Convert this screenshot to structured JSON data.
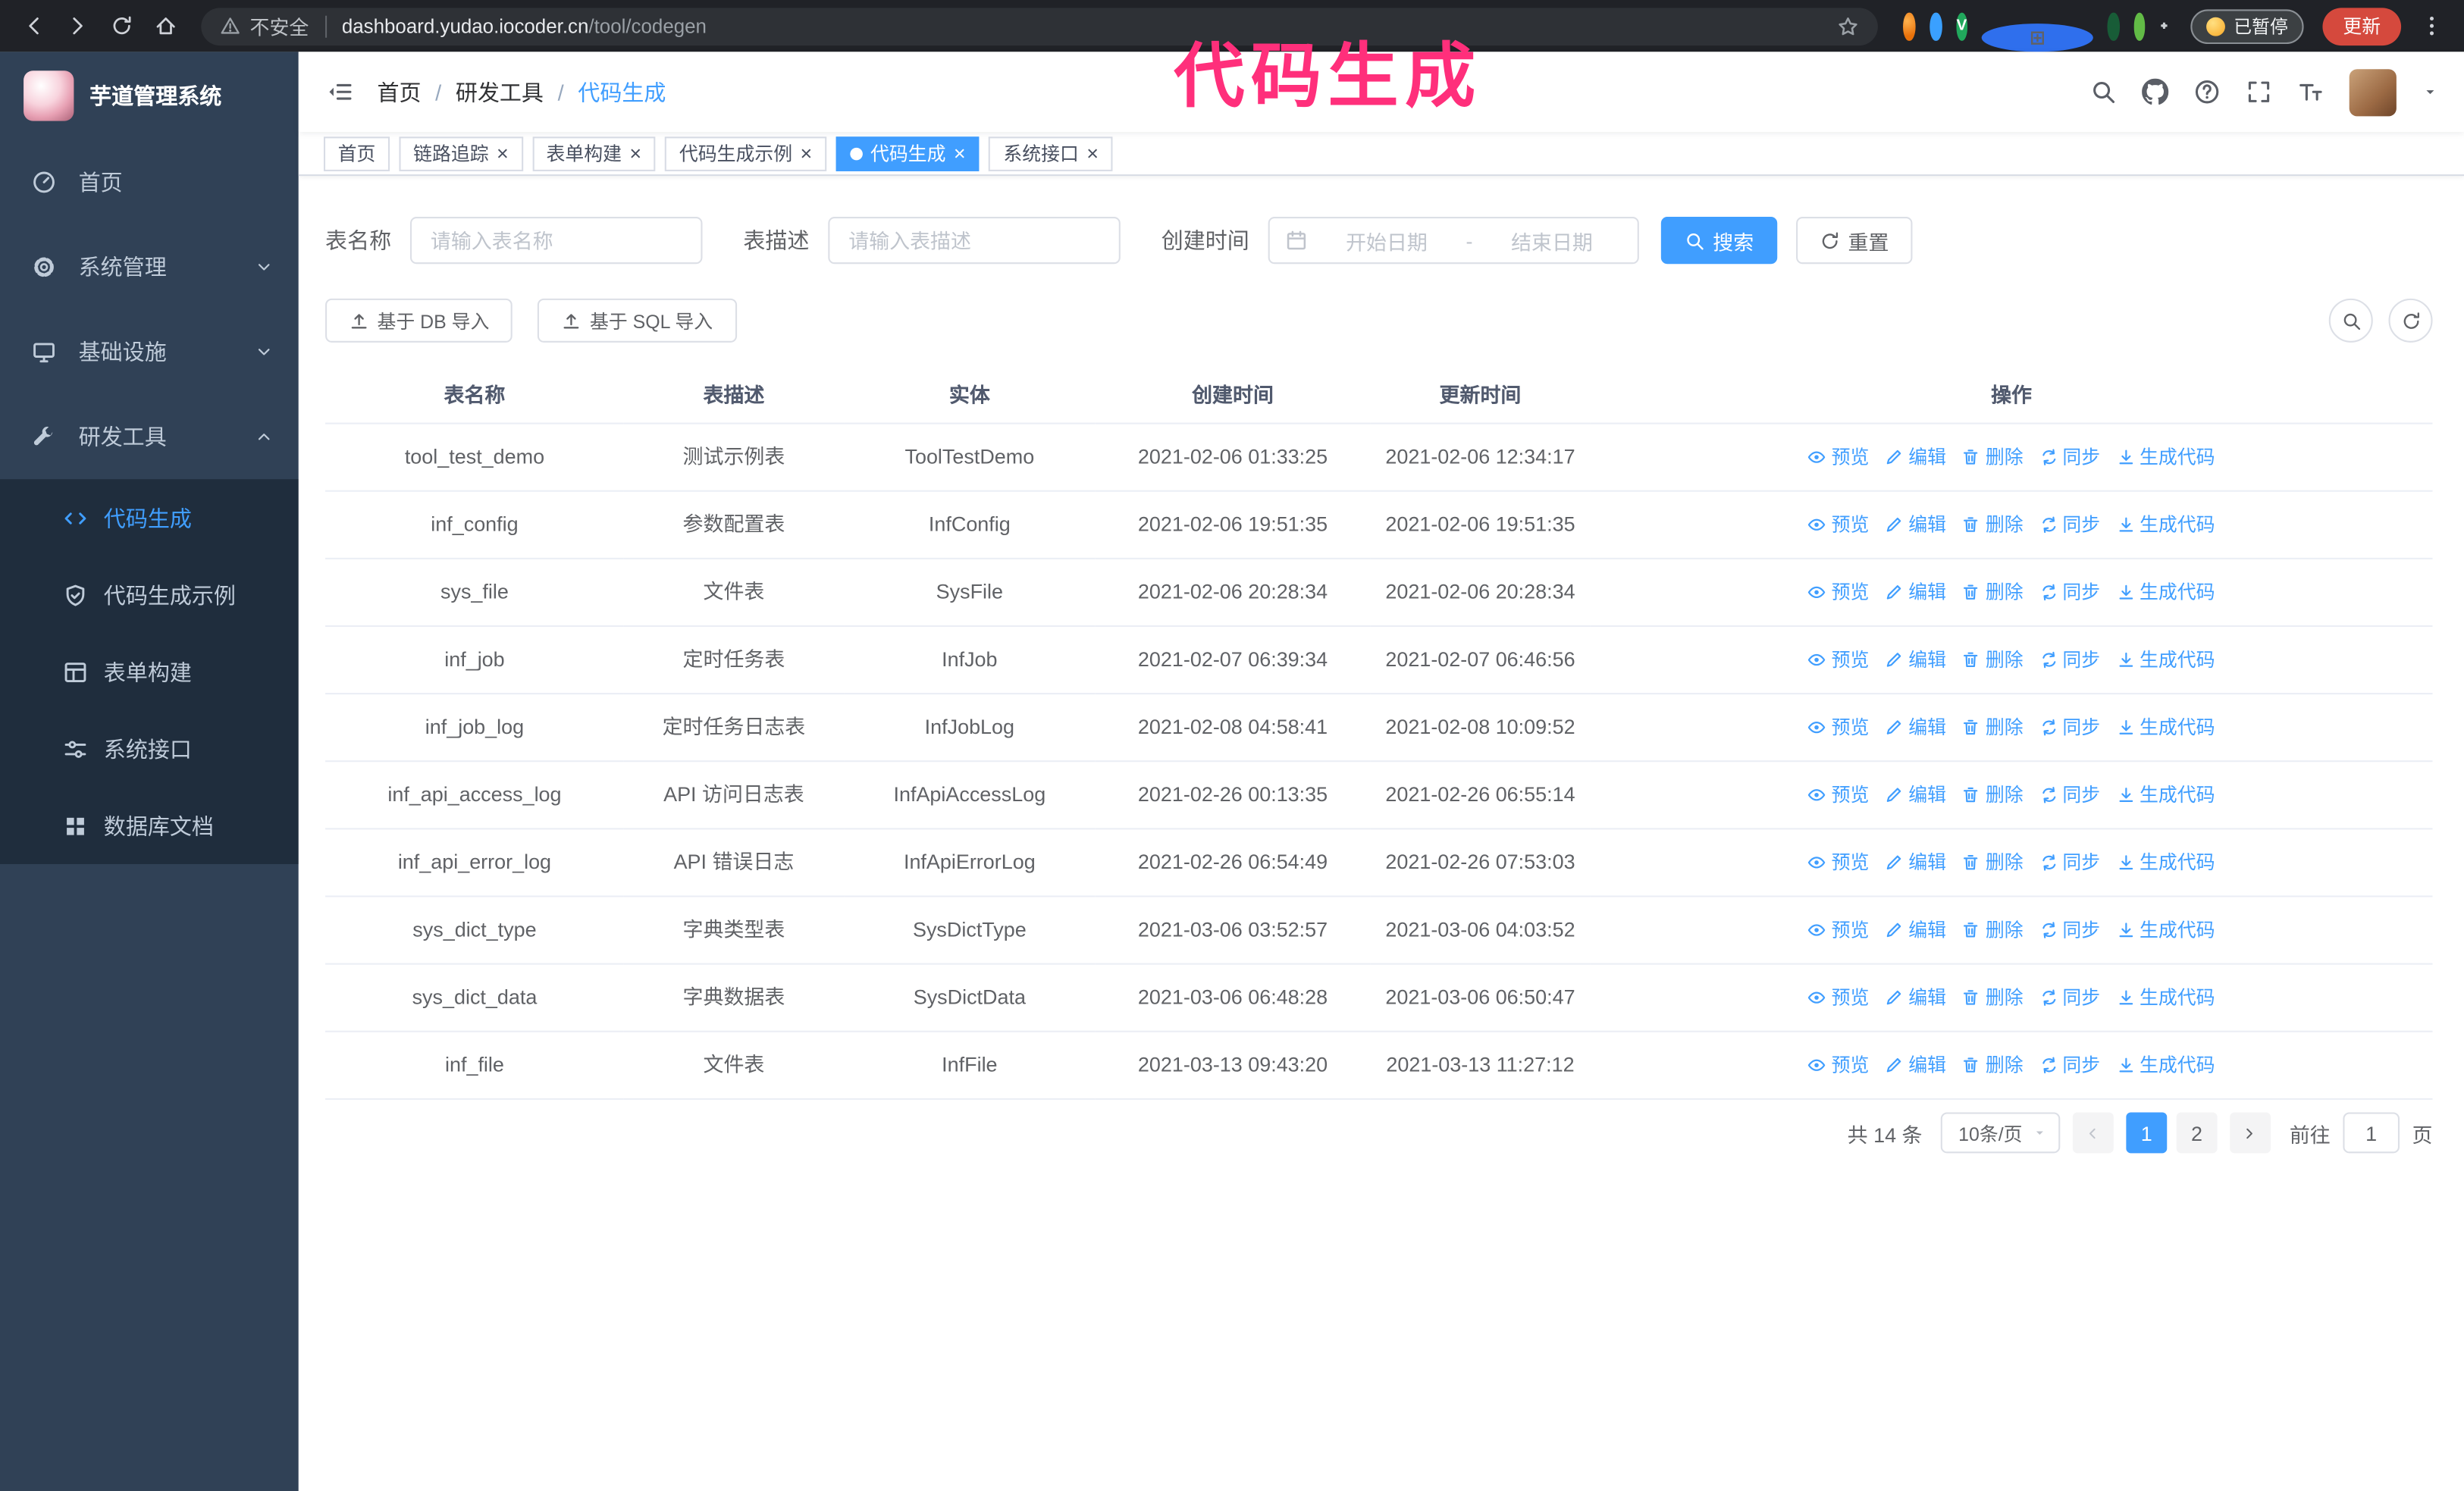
{
  "browser": {
    "security_label": "不安全",
    "url_host": "dashboard.yudao.iocoder.cn",
    "url_path": "/tool/codegen",
    "paused_badge": "已暂停",
    "update_button": "更新"
  },
  "annotation": {
    "text": "代码生成",
    "color": "#ff2f7b"
  },
  "sidebar": {
    "logo_title": "芋道管理系统",
    "items": [
      {
        "id": "home",
        "label": "首页",
        "icon": "dashboard-icon",
        "expandable": false,
        "expanded": false
      },
      {
        "id": "system",
        "label": "系统管理",
        "icon": "gear-icon",
        "expandable": true,
        "expanded": false
      },
      {
        "id": "infra",
        "label": "基础设施",
        "icon": "infra-icon",
        "expandable": true,
        "expanded": false
      },
      {
        "id": "dev-tools",
        "label": "研发工具",
        "icon": "tools-icon",
        "expandable": true,
        "expanded": true
      }
    ],
    "submenu": [
      {
        "id": "codegen",
        "label": "代码生成",
        "icon": "code-icon",
        "active": true
      },
      {
        "id": "codegen-demo",
        "label": "代码生成示例",
        "icon": "example-icon",
        "active": false
      },
      {
        "id": "form-builder",
        "label": "表单构建",
        "icon": "form-icon",
        "active": false
      },
      {
        "id": "api",
        "label": "系统接口",
        "icon": "api-icon",
        "active": false
      },
      {
        "id": "db-doc",
        "label": "数据库文档",
        "icon": "db-icon",
        "active": false
      }
    ]
  },
  "header": {
    "breadcrumb": [
      "首页",
      "研发工具",
      "代码生成"
    ]
  },
  "tabs": [
    {
      "id": "home",
      "label": "首页",
      "closable": false,
      "active": false
    },
    {
      "id": "tracer",
      "label": "链路追踪",
      "closable": true,
      "active": false
    },
    {
      "id": "form-builder",
      "label": "表单构建",
      "closable": true,
      "active": false
    },
    {
      "id": "codegen-demo",
      "label": "代码生成示例",
      "closable": true,
      "active": false
    },
    {
      "id": "codegen",
      "label": "代码生成",
      "closable": true,
      "active": true
    },
    {
      "id": "api",
      "label": "系统接口",
      "closable": true,
      "active": false
    }
  ],
  "filters": {
    "table_name_label": "表名称",
    "table_name_placeholder": "请输入表名称",
    "table_desc_label": "表描述",
    "table_desc_placeholder": "请输入表描述",
    "create_time_label": "创建时间",
    "date_start_placeholder": "开始日期",
    "date_separator": "-",
    "date_end_placeholder": "结束日期",
    "search_button": "搜索",
    "reset_button": "重置"
  },
  "toolbar": {
    "import_db_button": "基于 DB 导入",
    "import_sql_button": "基于 SQL 导入"
  },
  "table": {
    "columns": [
      "表名称",
      "表描述",
      "实体",
      "创建时间",
      "更新时间",
      "操作"
    ],
    "op_labels": [
      {
        "id": "preview",
        "label": "预览",
        "icon": "eye-icon"
      },
      {
        "id": "edit",
        "label": "编辑",
        "icon": "edit-icon"
      },
      {
        "id": "delete",
        "label": "删除",
        "icon": "delete-icon"
      },
      {
        "id": "sync",
        "label": "同步",
        "icon": "sync-icon"
      },
      {
        "id": "generate",
        "label": "生成代码",
        "icon": "download-icon"
      }
    ],
    "rows": [
      {
        "name": "tool_test_demo",
        "desc": "测试示例表",
        "entity": "ToolTestDemo",
        "create_time": "2021-02-06 01:33:25",
        "update_time": "2021-02-06 12:34:17"
      },
      {
        "name": "inf_config",
        "desc": "参数配置表",
        "entity": "InfConfig",
        "create_time": "2021-02-06 19:51:35",
        "update_time": "2021-02-06 19:51:35"
      },
      {
        "name": "sys_file",
        "desc": "文件表",
        "entity": "SysFile",
        "create_time": "2021-02-06 20:28:34",
        "update_time": "2021-02-06 20:28:34"
      },
      {
        "name": "inf_job",
        "desc": "定时任务表",
        "entity": "InfJob",
        "create_time": "2021-02-07 06:39:34",
        "update_time": "2021-02-07 06:46:56"
      },
      {
        "name": "inf_job_log",
        "desc": "定时任务日志表",
        "entity": "InfJobLog",
        "create_time": "2021-02-08 04:58:41",
        "update_time": "2021-02-08 10:09:52"
      },
      {
        "name": "inf_api_access_log",
        "desc": "API 访问日志表",
        "entity": "InfApiAccessLog",
        "create_time": "2021-02-26 00:13:35",
        "update_time": "2021-02-26 06:55:14"
      },
      {
        "name": "inf_api_error_log",
        "desc": "API 错误日志",
        "entity": "InfApiErrorLog",
        "create_time": "2021-02-26 06:54:49",
        "update_time": "2021-02-26 07:53:03"
      },
      {
        "name": "sys_dict_type",
        "desc": "字典类型表",
        "entity": "SysDictType",
        "create_time": "2021-03-06 03:52:57",
        "update_time": "2021-03-06 04:03:52"
      },
      {
        "name": "sys_dict_data",
        "desc": "字典数据表",
        "entity": "SysDictData",
        "create_time": "2021-03-06 06:48:28",
        "update_time": "2021-03-06 06:50:47"
      },
      {
        "name": "inf_file",
        "desc": "文件表",
        "entity": "InfFile",
        "create_time": "2021-03-13 09:43:20",
        "update_time": "2021-03-13 11:27:12"
      }
    ]
  },
  "pagination": {
    "total_text": "共 14 条",
    "page_size": "10条/页",
    "pages": [
      "1",
      "2"
    ],
    "active_page": "1",
    "goto_label": "前往",
    "goto_value": "1",
    "goto_suffix": "页"
  }
}
